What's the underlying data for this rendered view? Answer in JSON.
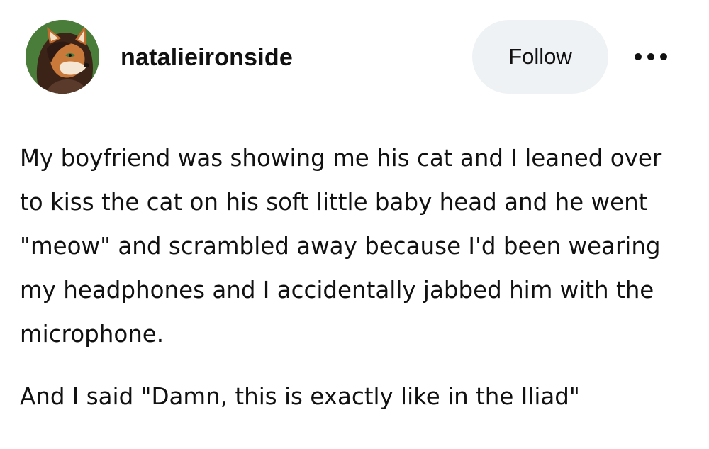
{
  "post": {
    "author": {
      "username": "natalieironside",
      "avatar_icon": "fox-character-avatar"
    },
    "follow_label": "Follow",
    "more_icon": "ellipsis-icon",
    "paragraphs": [
      "My boyfriend was showing me his cat and I leaned over to kiss the cat on his soft little baby head and he went \"meow\" and scrambled away because I'd been wearing my headphones and I accidentally jabbed him with the microphone.",
      "And I said \"Damn, this is exactly like in the Iliad\""
    ]
  },
  "colors": {
    "follow_bg": "#eef2f4",
    "text": "#111111",
    "avatar_bg": "#4a7d3a"
  }
}
